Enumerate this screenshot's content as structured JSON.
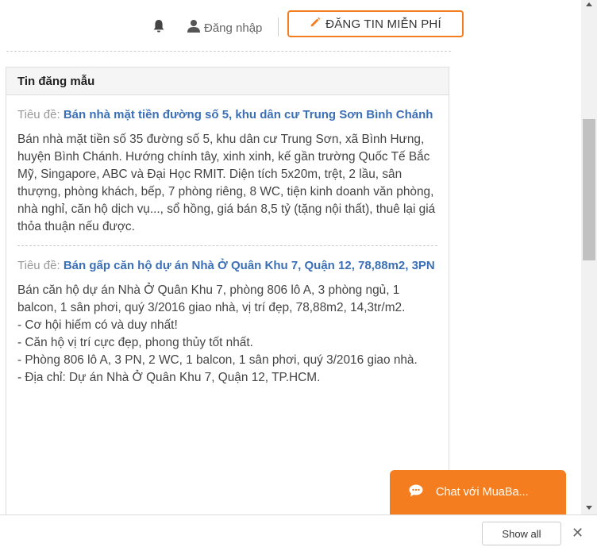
{
  "header": {
    "bell_icon": "bell-icon",
    "user_icon": "user-icon",
    "login_label": "Đăng nhập",
    "post_button_label": "ĐĂNG TIN MIỄN PHÍ",
    "post_button_icon": "pencil-icon",
    "accent_color": "#f47d20"
  },
  "panel": {
    "title": "Tin đăng mẫu",
    "items": [
      {
        "prefix": "Tiêu đề:",
        "title": "Bán nhà mặt tiền đường số 5, khu dân cư Trung Sơn Bình Chánh",
        "body": "Bán nhà mặt tiền số 35 đường số 5, khu dân cư Trung Sơn, xã Bình Hưng, huyện Bình Chánh. Hướng chính tây, xinh xinh, kế gần trường Quốc Tế Bắc Mỹ, Singapore, ABC và Đại Học RMIT. Diện tích 5x20m, trệt, 2 lầu, sân thượng, phòng khách, bếp, 7 phòng riêng, 8 WC, tiện kinh doanh văn phòng, nhà nghỉ, căn hộ dịch vụ..., sổ hồng, giá bán 8,5 tỷ (tặng nội thất), thuê lại giá thỏa thuận nếu được."
      },
      {
        "prefix": "Tiêu đề:",
        "title": "Bán gấp căn hộ dự án Nhà Ở Quân Khu 7, Quận 12, 78,88m2, 3PN",
        "body": "Bán căn hộ dự án Nhà Ở Quân Khu 7, phòng 806 lô A, 3 phòng ngủ, 1 balcon, 1 sân phơi, quý 3/2016 giao nhà, vị trí đẹp, 78,88m2, 14,3tr/m2.\n- Cơ hội hiếm có và duy nhất!\n- Căn hộ vị trí cực đẹp, phong thủy tốt nhất.\n- Phòng 806 lô A, 3 PN, 2 WC, 1 balcon, 1 sân phơi, quý 3/2016 giao nhà.\n- Địa chỉ: Dự án Nhà Ở Quân Khu 7, Quận 12, TP.HCM."
      }
    ]
  },
  "chat": {
    "label": "Chat với MuaBa...",
    "icon": "chat-bubble-icon"
  },
  "bottom_bar": {
    "show_all_label": "Show all",
    "close_label": "✕"
  }
}
